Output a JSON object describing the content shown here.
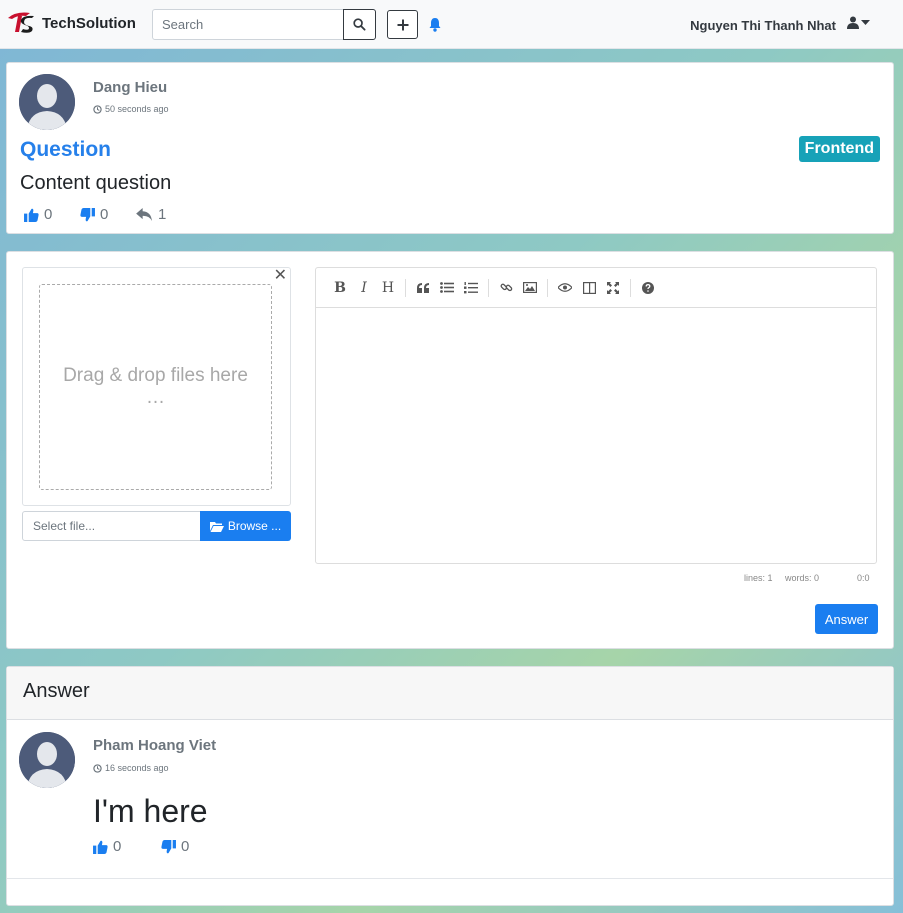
{
  "navbar": {
    "brand": "TechSolution",
    "search_placeholder": "Search",
    "user_name": "Nguyen Thi Thanh Nhat"
  },
  "question": {
    "author": "Dang Hieu",
    "time": "50 seconds ago",
    "title": "Question",
    "tag": "Frontend",
    "content": "Content question",
    "likes": "0",
    "dislikes": "0",
    "replies": "1"
  },
  "editor": {
    "drop_text": "Drag & drop files here",
    "drop_ellipsis": "…",
    "file_placeholder": "Select file...",
    "browse_label": "Browse ...",
    "status_lines": "lines: 1",
    "status_words": "words: 0",
    "status_cursor": "0:0",
    "submit_label": "Answer"
  },
  "answers": {
    "header": "Answer",
    "items": [
      {
        "author": "Pham Hoang Viet",
        "time": "16 seconds ago",
        "content": "I'm here",
        "likes": "0",
        "dislikes": "0"
      }
    ]
  },
  "colors": {
    "primary": "#1a7ef0",
    "tag": "#17a2b8",
    "title": "#2680ea"
  }
}
